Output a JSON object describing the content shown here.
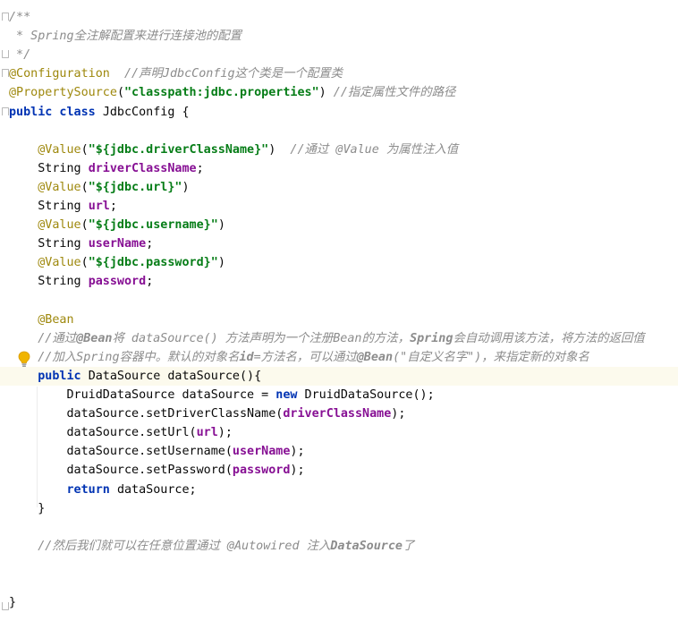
{
  "editor": {
    "lines": [
      [
        {
          "t": "/**",
          "c": "doc"
        }
      ],
      [
        {
          "t": " * Spring全注解配置来进行连接池的配置",
          "c": "doc"
        }
      ],
      [
        {
          "t": " */",
          "c": "doc"
        }
      ],
      [
        {
          "t": "@Configuration",
          "c": "annot"
        },
        {
          "t": "  //声明JdbcConfig这个类是一个配置类",
          "c": "comment"
        }
      ],
      [
        {
          "t": "@PropertySource",
          "c": "annot"
        },
        {
          "t": "(",
          "c": "plain"
        },
        {
          "t": "\"classpath:jdbc.properties\"",
          "c": "str"
        },
        {
          "t": ") ",
          "c": "plain"
        },
        {
          "t": "//指定属性文件的路径",
          "c": "comment"
        }
      ],
      [
        {
          "t": "public class ",
          "c": "kw"
        },
        {
          "t": "JdbcConfig {",
          "c": "plain"
        }
      ],
      [],
      [
        {
          "t": "    ",
          "c": "plain"
        },
        {
          "t": "@Value",
          "c": "annot"
        },
        {
          "t": "(",
          "c": "plain"
        },
        {
          "t": "\"${jdbc.driverClassName}\"",
          "c": "str"
        },
        {
          "t": ")  ",
          "c": "plain"
        },
        {
          "t": "//通过 @Value 为属性注入值",
          "c": "comment"
        }
      ],
      [
        {
          "t": "    String ",
          "c": "plain"
        },
        {
          "t": "driverClassName",
          "c": "field"
        },
        {
          "t": ";",
          "c": "plain"
        }
      ],
      [
        {
          "t": "    ",
          "c": "plain"
        },
        {
          "t": "@Value",
          "c": "annot"
        },
        {
          "t": "(",
          "c": "plain"
        },
        {
          "t": "\"${jdbc.url}\"",
          "c": "str"
        },
        {
          "t": ")",
          "c": "plain"
        }
      ],
      [
        {
          "t": "    String ",
          "c": "plain"
        },
        {
          "t": "url",
          "c": "field"
        },
        {
          "t": ";",
          "c": "plain"
        }
      ],
      [
        {
          "t": "    ",
          "c": "plain"
        },
        {
          "t": "@Value",
          "c": "annot"
        },
        {
          "t": "(",
          "c": "plain"
        },
        {
          "t": "\"${jdbc.username}\"",
          "c": "str"
        },
        {
          "t": ")",
          "c": "plain"
        }
      ],
      [
        {
          "t": "    String ",
          "c": "plain"
        },
        {
          "t": "userName",
          "c": "field"
        },
        {
          "t": ";",
          "c": "plain"
        }
      ],
      [
        {
          "t": "    ",
          "c": "plain"
        },
        {
          "t": "@Value",
          "c": "annot"
        },
        {
          "t": "(",
          "c": "plain"
        },
        {
          "t": "\"${jdbc.password}\"",
          "c": "str"
        },
        {
          "t": ")",
          "c": "plain"
        }
      ],
      [
        {
          "t": "    String ",
          "c": "plain"
        },
        {
          "t": "password",
          "c": "field"
        },
        {
          "t": ";",
          "c": "plain"
        }
      ],
      [],
      [
        {
          "t": "    ",
          "c": "plain"
        },
        {
          "t": "@Bean",
          "c": "annot"
        }
      ],
      [
        {
          "t": "    ",
          "c": "plain"
        },
        {
          "t": "//通过",
          "c": "comment"
        },
        {
          "t": "@Bean",
          "c": "boldc"
        },
        {
          "t": "将 dataSource() 方法声明为一个注册Bean的方法，",
          "c": "comment"
        },
        {
          "t": "Spring",
          "c": "boldc"
        },
        {
          "t": "会自动调用该方法，将方法的返回值",
          "c": "comment"
        }
      ],
      [
        {
          "t": "    ",
          "c": "plain"
        },
        {
          "t": "//加入Spring容器中。默认的对象名",
          "c": "comment"
        },
        {
          "t": "id",
          "c": "boldc"
        },
        {
          "t": "=方法名，可以通过",
          "c": "comment"
        },
        {
          "t": "@Bean",
          "c": "boldc"
        },
        {
          "t": "(\"自定义名字\")，来指定新的对象名",
          "c": "comment"
        }
      ],
      [
        {
          "t": "    ",
          "c": "plain"
        },
        {
          "t": "public ",
          "c": "kw"
        },
        {
          "t": "DataSource dataSource(){",
          "c": "plain"
        }
      ],
      [
        {
          "t": "        DruidDataSource dataSource = ",
          "c": "plain"
        },
        {
          "t": "new ",
          "c": "kw"
        },
        {
          "t": "DruidDataSource();",
          "c": "plain"
        }
      ],
      [
        {
          "t": "        dataSource.setDriverClassName(",
          "c": "plain"
        },
        {
          "t": "driverClassName",
          "c": "field"
        },
        {
          "t": ");",
          "c": "plain"
        }
      ],
      [
        {
          "t": "        dataSource.setUrl(",
          "c": "plain"
        },
        {
          "t": "url",
          "c": "field"
        },
        {
          "t": ");",
          "c": "plain"
        }
      ],
      [
        {
          "t": "        dataSource.setUsername(",
          "c": "plain"
        },
        {
          "t": "userName",
          "c": "field"
        },
        {
          "t": ");",
          "c": "plain"
        }
      ],
      [
        {
          "t": "        dataSource.setPassword(",
          "c": "plain"
        },
        {
          "t": "password",
          "c": "field"
        },
        {
          "t": ");",
          "c": "plain"
        }
      ],
      [
        {
          "t": "        ",
          "c": "plain"
        },
        {
          "t": "return ",
          "c": "kw"
        },
        {
          "t": "dataSource;",
          "c": "plain"
        }
      ],
      [
        {
          "t": "    }",
          "c": "plain"
        }
      ],
      [],
      [
        {
          "t": "    ",
          "c": "plain"
        },
        {
          "t": "//然后我们就可以在任意位置通过 @Autowired 注入",
          "c": "comment"
        },
        {
          "t": "DataSource",
          "c": "boldc"
        },
        {
          "t": "了",
          "c": "comment"
        }
      ],
      [],
      [],
      [
        {
          "t": "}",
          "c": "plain"
        }
      ]
    ],
    "highlighted_line": 19,
    "colors": {
      "background": "#ffffff",
      "current_line": "#fcfaed",
      "keyword": "#0033b3",
      "string": "#067d17",
      "annotation": "#9e880d",
      "field": "#871094",
      "comment": "#8c8c8c"
    },
    "gutter_icons": {
      "intention_bulb": "lightbulb-icon",
      "fold_marker": "fold-marker-icon"
    }
  }
}
